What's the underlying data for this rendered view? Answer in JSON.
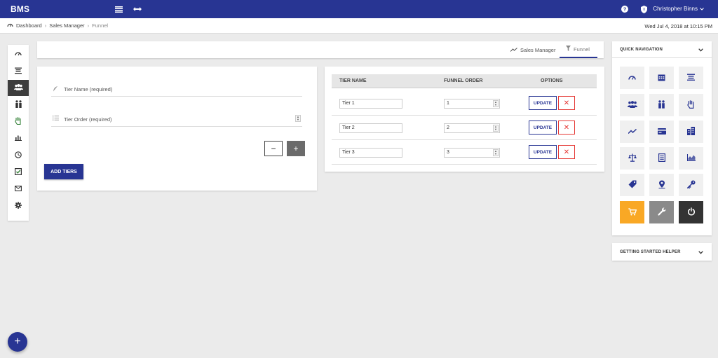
{
  "app": {
    "brand": "BMS",
    "user_name": "Christopher Binns"
  },
  "breadcrumb": {
    "items": [
      "Dashboard",
      "Sales Manager",
      "Funnel"
    ],
    "separator": "›"
  },
  "datetime": "Wed Jul 4, 2018 at 10:15 PM",
  "tabs": [
    {
      "label": "Sales Manager",
      "icon": "trending-up-icon"
    },
    {
      "label": "Funnel",
      "icon": "filter-icon",
      "active": true
    }
  ],
  "form": {
    "tier_name_placeholder": "Tier Name (required)",
    "tier_order_placeholder": "Tier Order (required)",
    "minus_label": "−",
    "plus_label": "+",
    "add_label": "ADD TIERS"
  },
  "table": {
    "headers": [
      "TIER NAME",
      "FUNNEL ORDER",
      "OPTIONS"
    ],
    "rows": [
      {
        "name": "Tier 1",
        "order": "1"
      },
      {
        "name": "Tier 2",
        "order": "2"
      },
      {
        "name": "Tier 3",
        "order": "3"
      }
    ],
    "update_label": "UPDATE",
    "delete_label": "✕"
  },
  "quick_nav": {
    "title": "QUICK NAVIGATION",
    "tiles": [
      "gauge-icon",
      "calendar-icon",
      "list-icon",
      "people-icon",
      "users-pair-icon",
      "hand-icon",
      "trend-icon",
      "credit-card-icon",
      "building-icon",
      "scale-icon",
      "document-icon",
      "chart-icon",
      "tag-icon",
      "location-icon",
      "key-icon",
      "cart-icon",
      "wrench-icon",
      "power-icon"
    ]
  },
  "getting_started": {
    "title": "GETTING STARTED HELPER"
  },
  "fab_label": "+",
  "colors": {
    "primary": "#283593",
    "danger": "#e53935",
    "cart_tile": "#f9a825",
    "wrench_tile": "#8a8a8a",
    "power_tile": "#333333"
  }
}
